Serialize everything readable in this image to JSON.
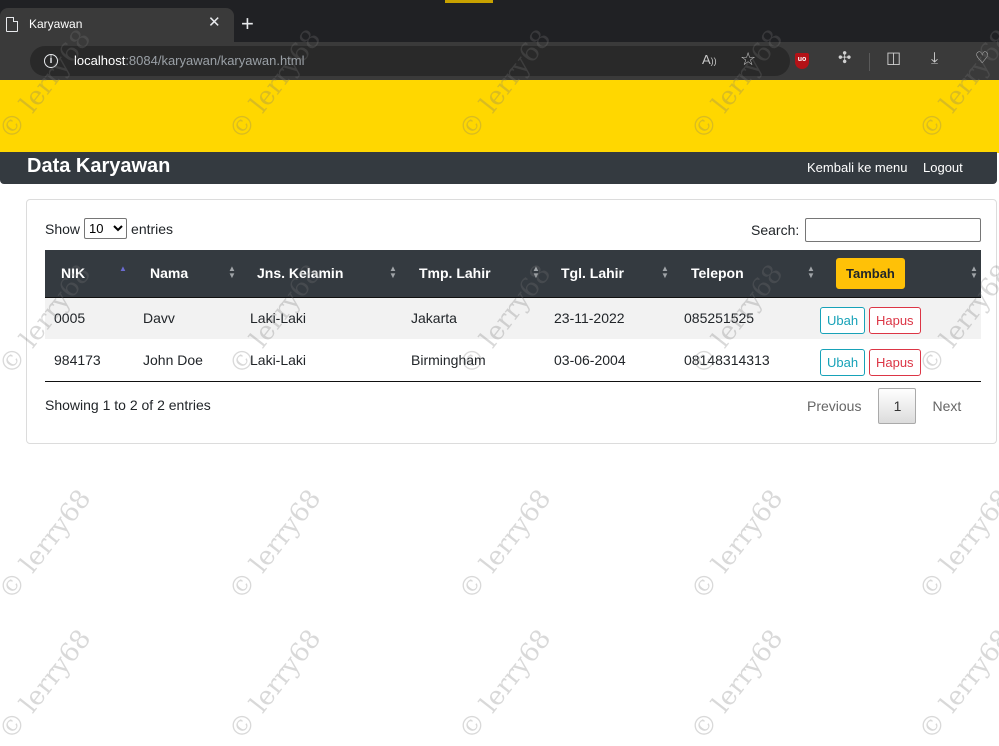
{
  "browser": {
    "tab_title": "Karyawan",
    "tab_close": "✕",
    "new_tab": "+",
    "url_host": "localhost",
    "url_path": ":8084/karyawan/karyawan.html",
    "info_icon": "i",
    "read_aloud": "A&#8217;",
    "favorite_icon": "☆"
  },
  "navbar": {
    "brand": "Data Karyawan",
    "links": [
      "Kembali ke menu",
      "Logout"
    ]
  },
  "table_controls": {
    "show_label": "Show",
    "entries_label": "entries",
    "length_value": "10",
    "search_label": "Search:",
    "search_value": ""
  },
  "table": {
    "columns": [
      "NIK",
      "Nama",
      "Jns. Kelamin",
      "Tmp. Lahir",
      "Tgl. Lahir",
      "Telepon"
    ],
    "add_button": "Tambah",
    "rows": [
      {
        "nik": "0005",
        "nama": "Davv",
        "jk": "Laki-Laki",
        "tmp": "Jakarta",
        "tgl": "23-11-2022",
        "telp": "085251525"
      },
      {
        "nik": "984173",
        "nama": "John Doe",
        "jk": "Laki-Laki",
        "tmp": "Birmingham",
        "tgl": "03-06-2004",
        "telp": "08148314313"
      }
    ],
    "edit_label": "Ubah",
    "delete_label": "Hapus"
  },
  "footer": {
    "info": "Showing 1 to 2 of 2 entries",
    "previous": "Previous",
    "page": "1",
    "next": "Next"
  },
  "watermark_text": "© lerry68",
  "colors": {
    "header_band": "#ffd700",
    "navbar": "#343a40",
    "btn_tambah": "#ffc107",
    "btn_ubah": "#17a2b8",
    "btn_hapus": "#dc3545"
  }
}
